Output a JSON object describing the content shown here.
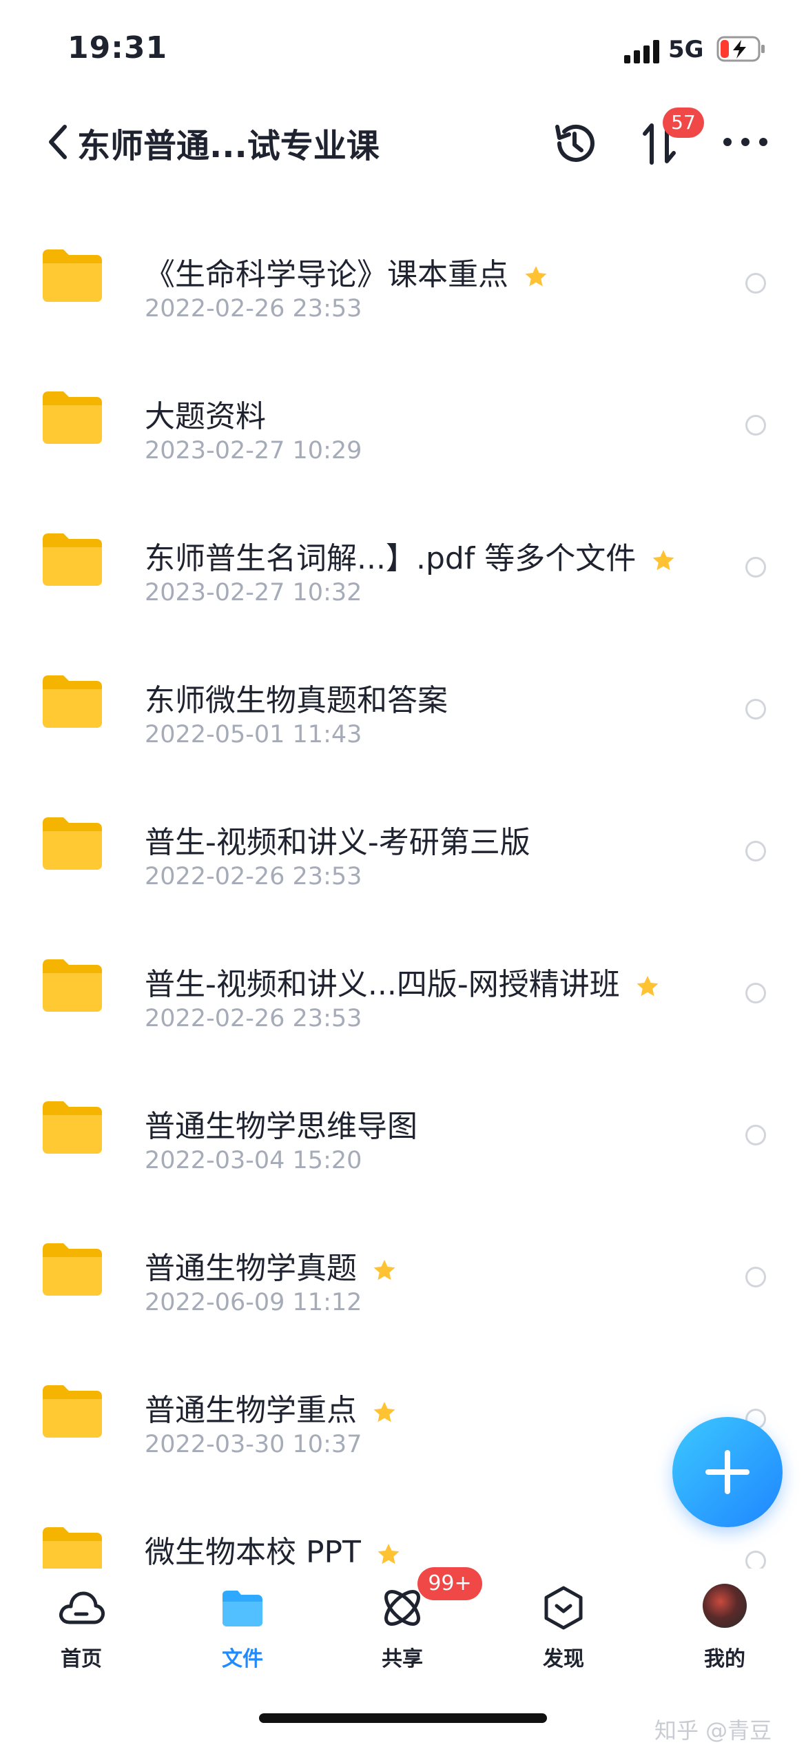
{
  "status_bar": {
    "time": "19:31",
    "network": "5G"
  },
  "navbar": {
    "title": "东师普通...试专业课",
    "transfer_count": "57"
  },
  "files": [
    {
      "name": "《生命科学导论》课本重点",
      "date": "2022-02-26 23:53",
      "starred": true
    },
    {
      "name": "大题资料",
      "date": "2023-02-27 10:29",
      "starred": false
    },
    {
      "name": "东师普生名词解...】.pdf 等多个文件",
      "date": "2023-02-27 10:32",
      "starred": true
    },
    {
      "name": "东师微生物真题和答案",
      "date": "2022-05-01 11:43",
      "starred": false
    },
    {
      "name": "普生-视频和讲义-考研第三版",
      "date": "2022-02-26 23:53",
      "starred": false
    },
    {
      "name": "普生-视频和讲义...四版-网授精讲班",
      "date": "2022-02-26 23:53",
      "starred": true
    },
    {
      "name": "普通生物学思维导图",
      "date": "2022-03-04 15:20",
      "starred": false
    },
    {
      "name": "普通生物学真题",
      "date": "2022-06-09 11:12",
      "starred": true
    },
    {
      "name": "普通生物学重点",
      "date": "2022-03-30 10:37",
      "starred": true
    },
    {
      "name": "微生物本校 PPT",
      "date": "",
      "starred": true
    }
  ],
  "tabbar": {
    "home": "首页",
    "files": "文件",
    "share": "共享",
    "share_badge": "99+",
    "discover": "发现",
    "mine": "我的"
  },
  "watermark": "知乎 @青豆",
  "colors": {
    "accent": "#1f8bff",
    "badge": "#f04747",
    "folder": "#ffc933",
    "star": "#ffc233"
  }
}
